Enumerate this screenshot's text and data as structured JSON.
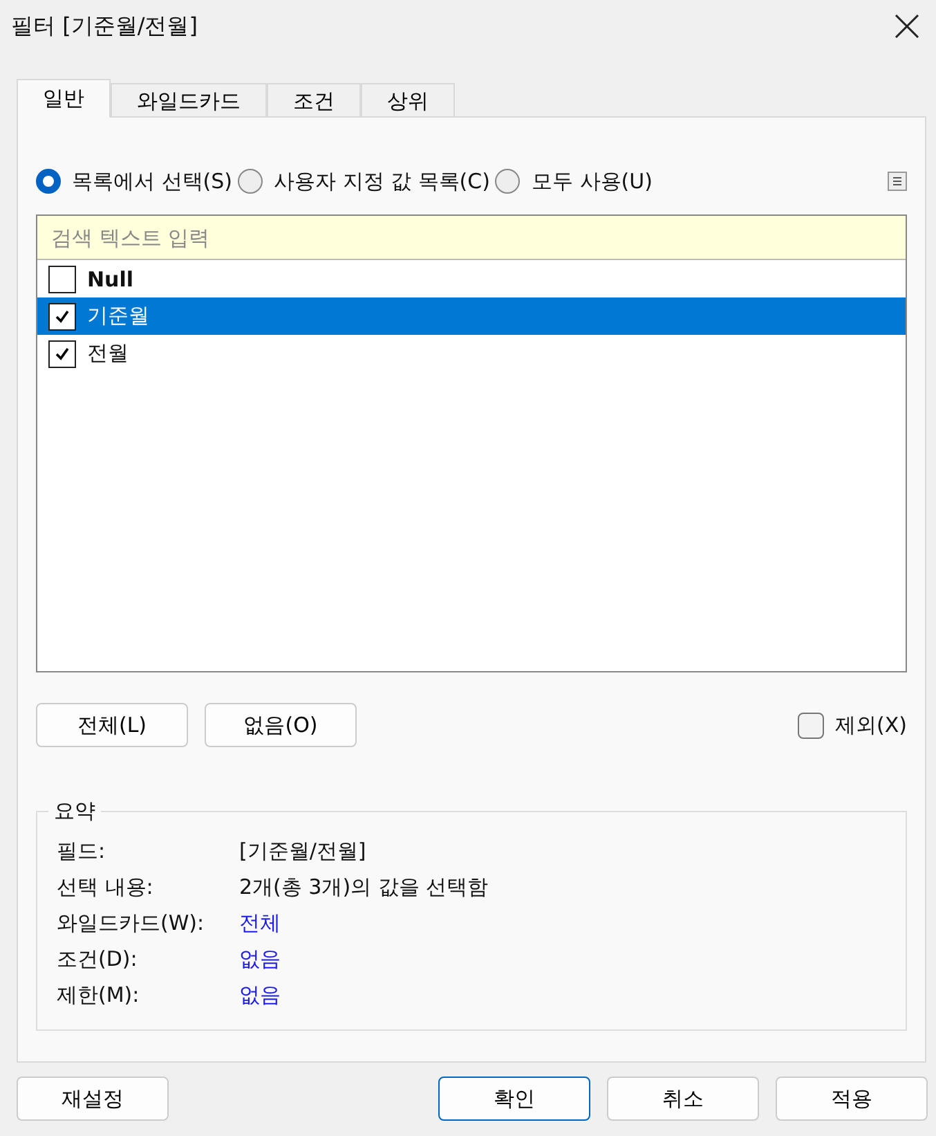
{
  "window": {
    "title": "필터 [기준월/전월]"
  },
  "tabs": [
    {
      "label": "일반",
      "selected": true
    },
    {
      "label": "와일드카드",
      "selected": false
    },
    {
      "label": "조건",
      "selected": false
    },
    {
      "label": "상위",
      "selected": false
    }
  ],
  "radios": [
    {
      "label": "목록에서 선택(S)",
      "selected": true
    },
    {
      "label": "사용자 지정 값 목록(C)",
      "selected": false
    },
    {
      "label": "모두 사용(U)",
      "selected": false
    }
  ],
  "search": {
    "placeholder": "검색 텍스트 입력"
  },
  "items": [
    {
      "label": "Null",
      "checked": false,
      "selected": false,
      "kind": "null"
    },
    {
      "label": "기준월",
      "checked": true,
      "selected": true,
      "kind": "value"
    },
    {
      "label": "전월",
      "checked": true,
      "selected": false,
      "kind": "value"
    }
  ],
  "list_buttons": [
    "전체(L)",
    "없음(O)"
  ],
  "exclude": {
    "label": "제외(X)",
    "checked": false
  },
  "summary": {
    "title": "요약",
    "rows": [
      {
        "label": "필드:",
        "value": "[기준월/전월]",
        "kind": "text"
      },
      {
        "label": "선택 내용:",
        "value": "2개(총 3개)의 값을 선택함",
        "kind": "text"
      },
      {
        "label": "와일드카드(W):",
        "value": "전체",
        "kind": "link"
      },
      {
        "label": "조건(D):",
        "value": "없음",
        "kind": "link"
      },
      {
        "label": "제한(M):",
        "value": "없음",
        "kind": "link"
      }
    ]
  },
  "reset_button": "재설정",
  "buttons": [
    {
      "label": "확인",
      "default": true
    },
    {
      "label": "취소",
      "default": false
    },
    {
      "label": "적용",
      "default": false
    }
  ]
}
